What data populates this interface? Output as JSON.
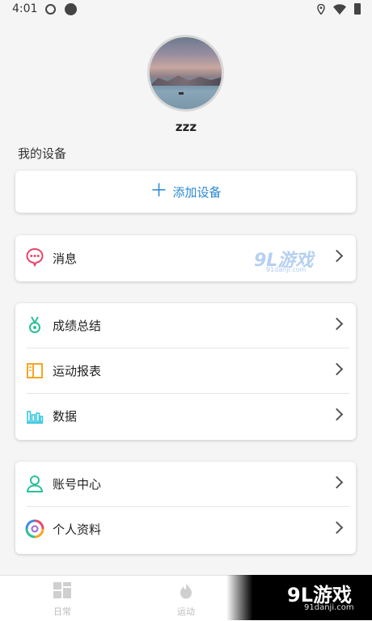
{
  "status_bar": {
    "time": "4:01"
  },
  "profile": {
    "username": "zzz"
  },
  "devices": {
    "section_title": "我的设备",
    "add_label": "添加设备",
    "add_icon": "plus-icon"
  },
  "menu": {
    "message": {
      "label": "消息",
      "icon": "chat-bubble-icon"
    },
    "stats": [
      {
        "label": "成绩总结",
        "icon": "medal-icon"
      },
      {
        "label": "运动报表",
        "icon": "book-icon"
      },
      {
        "label": "数据",
        "icon": "bar-chart-icon"
      }
    ],
    "account": [
      {
        "label": "账号中心",
        "icon": "user-icon"
      },
      {
        "label": "个人资料",
        "icon": "profile-swirl-icon"
      }
    ]
  },
  "watermark": {
    "logo": "9L游戏",
    "sub": "91danji.com"
  },
  "bottom_nav": [
    {
      "label": "日常",
      "icon": "grid-icon"
    },
    {
      "label": "运动",
      "icon": "flame-icon"
    }
  ],
  "promo": {
    "title": "9L游戏",
    "sub": "91danji.com"
  },
  "colors": {
    "accent": "#2a87d0",
    "message_icon": "#e8476a",
    "medal_icon": "#2bbf9a",
    "book_icon": "#f5a623",
    "chart_icon": "#3cc9e0",
    "user_icon": "#2bbf9a"
  }
}
